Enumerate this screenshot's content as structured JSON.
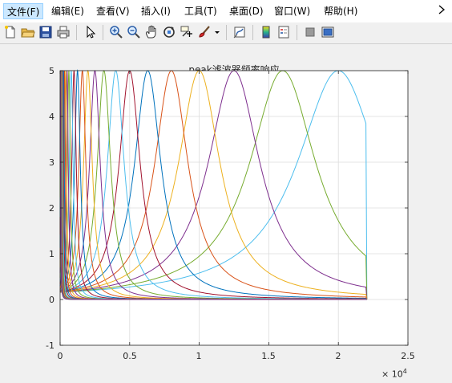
{
  "menu": {
    "items": [
      {
        "label": "文件(F)"
      },
      {
        "label": "编辑(E)"
      },
      {
        "label": "查看(V)"
      },
      {
        "label": "插入(I)"
      },
      {
        "label": "工具(T)"
      },
      {
        "label": "桌面(D)"
      },
      {
        "label": "窗口(W)"
      },
      {
        "label": "帮助(H)"
      }
    ],
    "overflow_icon": "chevron-right-icon"
  },
  "toolbar": {
    "icons": [
      "new-file-icon",
      "open-folder-icon",
      "save-icon",
      "print-icon",
      "pointer-icon",
      "zoom-in-icon",
      "zoom-out-icon",
      "pan-hand-icon",
      "rotate-3d-icon",
      "data-cursor-icon",
      "brush-icon",
      "dropdown-arrow-icon",
      "link-plot-icon",
      "insert-colorbar-icon",
      "insert-legend-icon",
      "hide-plot-tools-icon",
      "show-plot-tools-icon"
    ]
  },
  "chart_data": {
    "type": "line",
    "title": "peak滤波器频率响应",
    "xlabel": "",
    "ylabel": "",
    "xlim": [
      0,
      25000
    ],
    "ylim": [
      -1,
      5
    ],
    "x_tick_labels": [
      "0",
      "0.5",
      "1",
      "1.5",
      "2",
      "2.5"
    ],
    "y_tick_labels": [
      "-1",
      "0",
      "1",
      "2",
      "3",
      "4",
      "5"
    ],
    "x_exponent_label": "× 10",
    "x_exponent": "4",
    "grid": true,
    "x_data_end": 22050,
    "peak_gain": 5,
    "series": [
      {
        "center": 20000,
        "color": "#4DBEEE"
      },
      {
        "center": 16000,
        "color": "#77AC30"
      },
      {
        "center": 12500,
        "color": "#7E2F8E"
      },
      {
        "center": 10000,
        "color": "#EDB120"
      },
      {
        "center": 8000,
        "color": "#D95319"
      },
      {
        "center": 6300,
        "color": "#0072BD"
      },
      {
        "center": 5000,
        "color": "#A2142F"
      },
      {
        "center": 4000,
        "color": "#4DBEEE"
      },
      {
        "center": 3150,
        "color": "#77AC30"
      },
      {
        "center": 2500,
        "color": "#7E2F8E"
      },
      {
        "center": 2000,
        "color": "#EDB120"
      },
      {
        "center": 1600,
        "color": "#D95319"
      },
      {
        "center": 1250,
        "color": "#0072BD"
      },
      {
        "center": 1000,
        "color": "#A2142F"
      },
      {
        "center": 800,
        "color": "#4DBEEE"
      },
      {
        "center": 630,
        "color": "#77AC30"
      },
      {
        "center": 500,
        "color": "#7E2F8E"
      },
      {
        "center": 400,
        "color": "#EDB120"
      },
      {
        "center": 315,
        "color": "#D95319"
      },
      {
        "center": 250,
        "color": "#0072BD"
      },
      {
        "center": 200,
        "color": "#A2142F"
      },
      {
        "center": 160,
        "color": "#4DBEEE"
      },
      {
        "center": 125,
        "color": "#77AC30"
      },
      {
        "center": 100,
        "color": "#7E2F8E"
      },
      {
        "center": 80,
        "color": "#EDB120"
      },
      {
        "center": 63,
        "color": "#D95319"
      },
      {
        "center": 50,
        "color": "#0072BD"
      },
      {
        "center": 40,
        "color": "#A2142F"
      },
      {
        "center": 31.5,
        "color": "#4DBEEE"
      },
      {
        "center": 25,
        "color": "#77AC30"
      },
      {
        "center": 20,
        "color": "#7E2F8E"
      }
    ]
  }
}
